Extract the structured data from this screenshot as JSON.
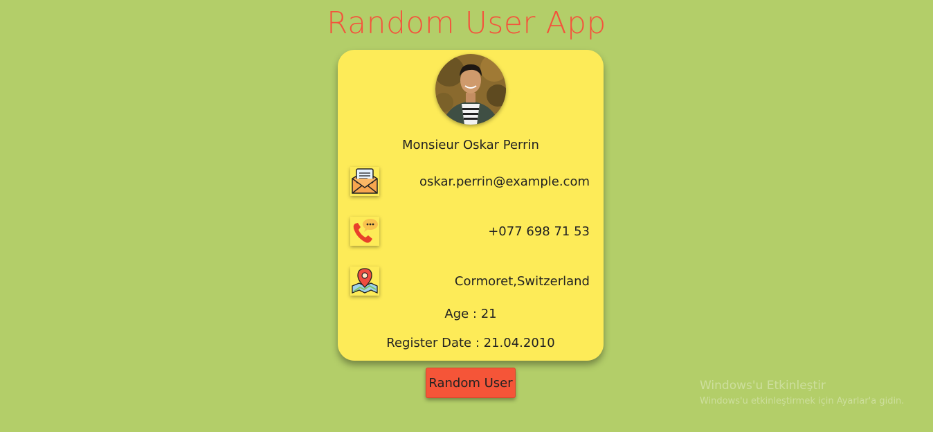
{
  "app": {
    "title": "Random User App"
  },
  "user": {
    "full_name": "Monsieur Oskar Perrin",
    "email": "oskar.perrin@example.com",
    "phone": "+077 698 71 53",
    "location": "Cormoret,Switzerland",
    "age_text": "Age : 21",
    "register_text": "Register Date : 21.04.2010"
  },
  "icons": {
    "email": "envelope-icon",
    "phone": "phone-icon",
    "location": "map-pin-icon"
  },
  "actions": {
    "random_user_label": "Random User"
  },
  "watermark": {
    "line1": "Windows'u Etkinleştir",
    "line2": "Windows'u etkinleştirmek için Ayarlar'a gidin."
  },
  "colors": {
    "background": "#b3ce69",
    "card": "#fdeb58",
    "accent": "#f4533c",
    "button": "#f55538"
  }
}
